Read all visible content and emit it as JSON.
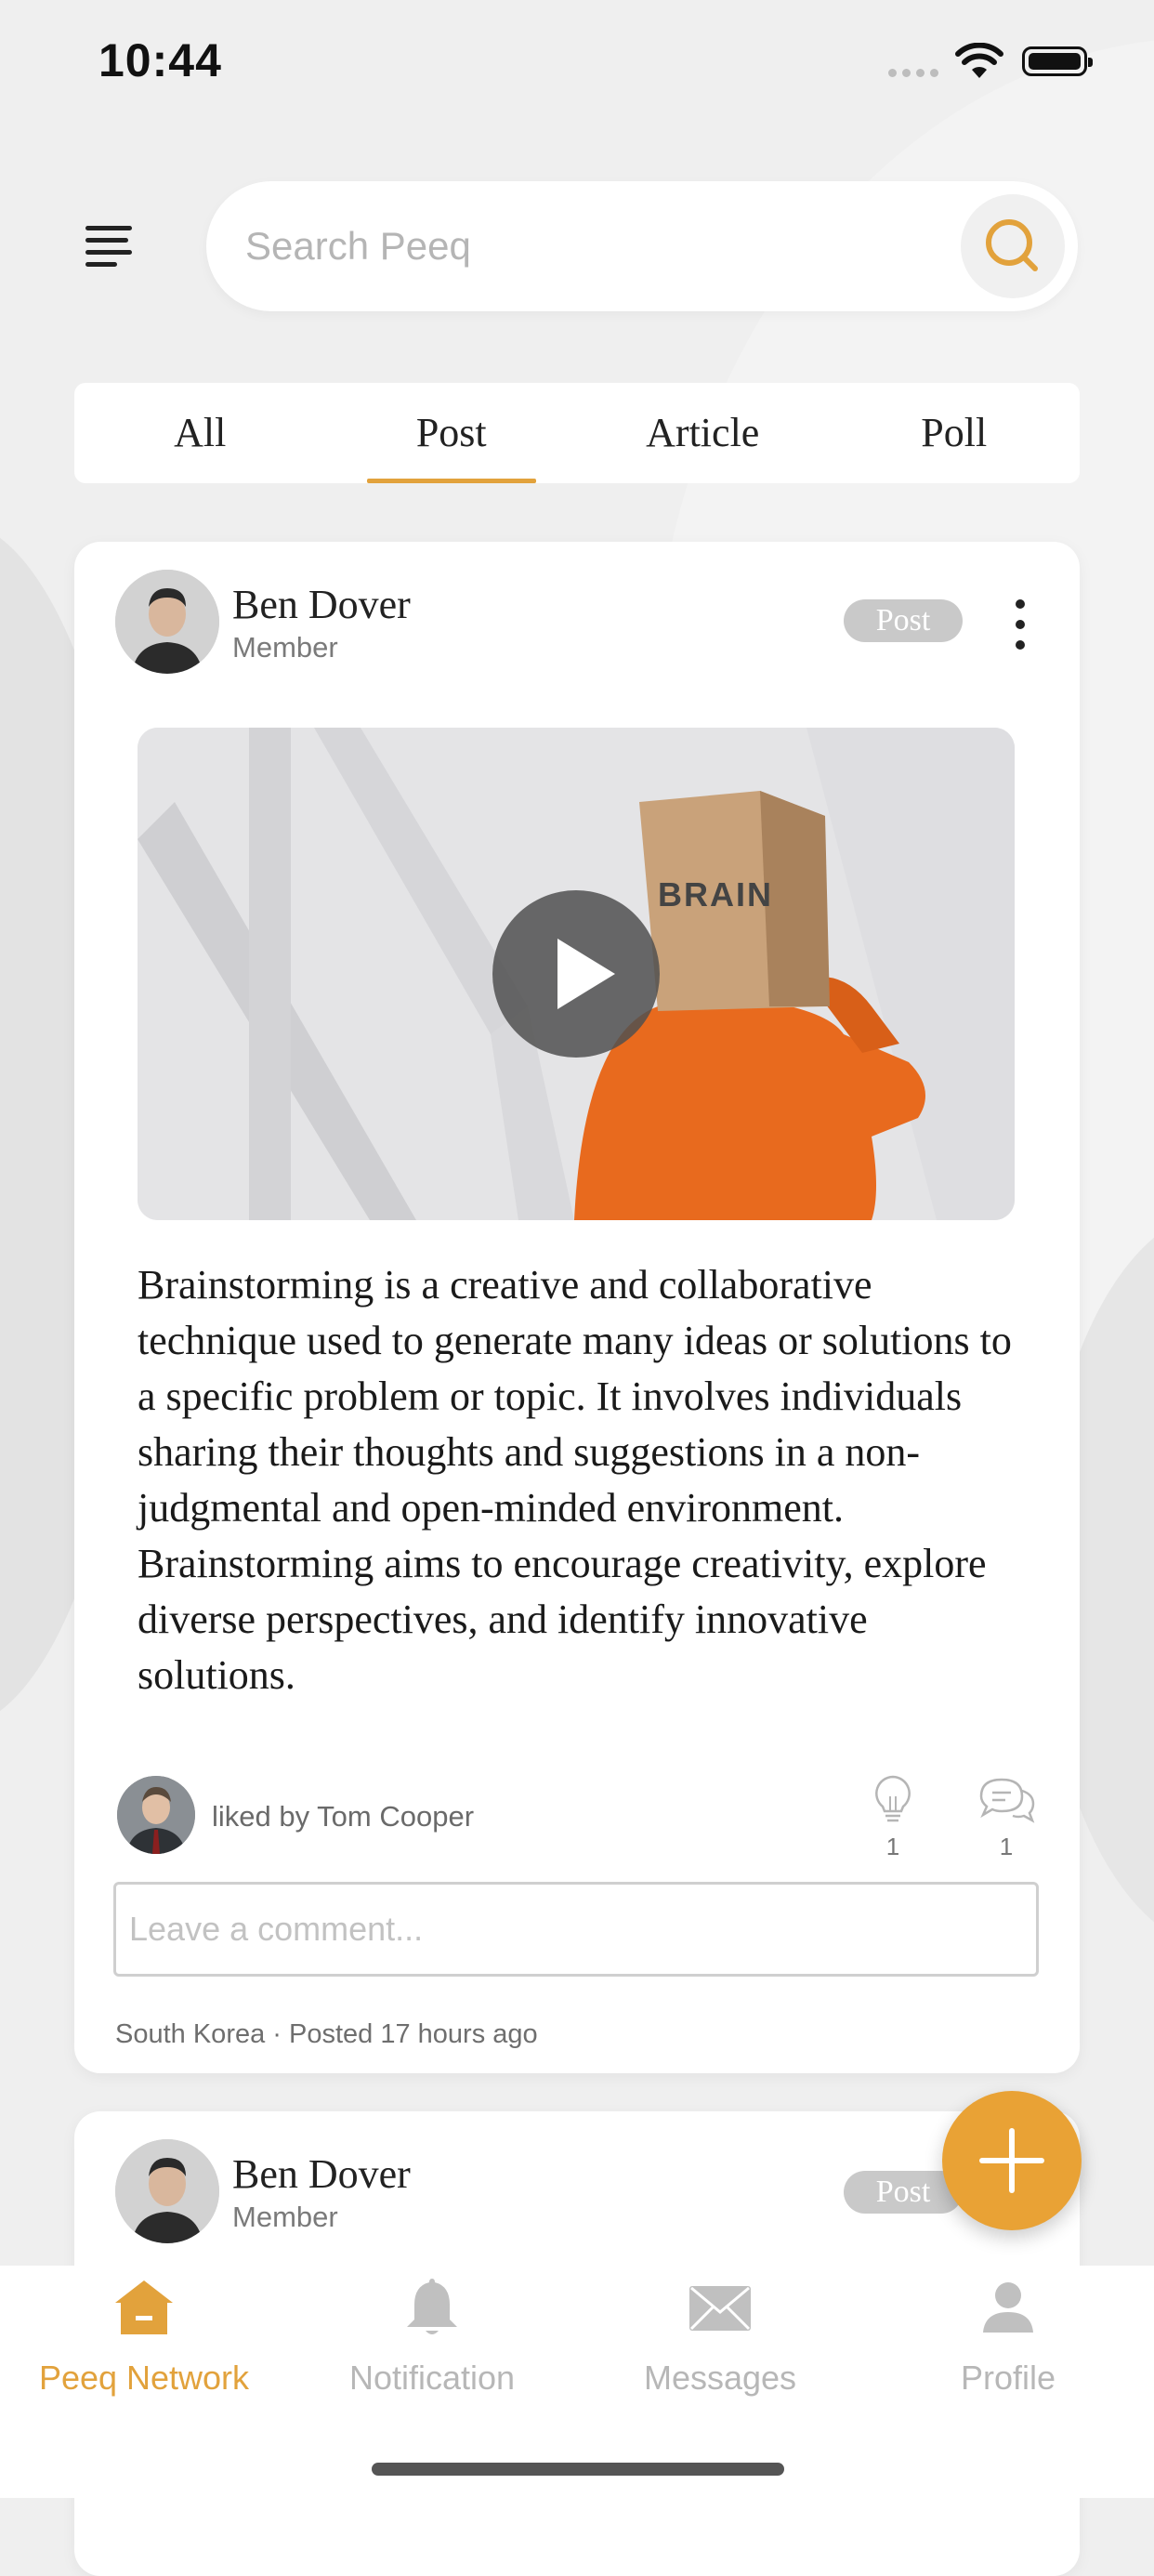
{
  "status_bar": {
    "time": "10:44"
  },
  "search": {
    "placeholder": "Search Peeq"
  },
  "tabs": [
    {
      "label": "All",
      "active": false
    },
    {
      "label": "Post",
      "active": true
    },
    {
      "label": "Article",
      "active": false
    },
    {
      "label": "Poll",
      "active": false
    }
  ],
  "posts": [
    {
      "author": "Ben Dover",
      "role": "Member",
      "badge": "Post",
      "media_type": "video",
      "media_caption": "BRAIN",
      "text": "Brainstorming is a creative and collaborative technique used to generate many ideas or solutions to a specific problem or topic. It involves individuals sharing their thoughts and suggestions in a non-judgmental and open-minded environment. Brainstorming aims to encourage creativity, explore diverse perspectives, and identify innovative solutions.",
      "liked_by": "liked by Tom Cooper",
      "likes_count": "1",
      "comments_count": "1",
      "comment_placeholder": "Leave a comment...",
      "meta": "South Korea · Posted 17 hours ago"
    },
    {
      "author": "Ben Dover",
      "role": "Member",
      "badge": "Post"
    }
  ],
  "bottom_nav": [
    {
      "label": "Peeq Network",
      "icon": "home-icon",
      "active": true
    },
    {
      "label": "Notification",
      "icon": "bell-icon",
      "active": false
    },
    {
      "label": "Messages",
      "icon": "envelope-icon",
      "active": false
    },
    {
      "label": "Profile",
      "icon": "person-icon",
      "active": false
    }
  ],
  "colors": {
    "accent": "#e2a23c",
    "fab": "#e9a235",
    "badge": "#c9c9c9"
  }
}
